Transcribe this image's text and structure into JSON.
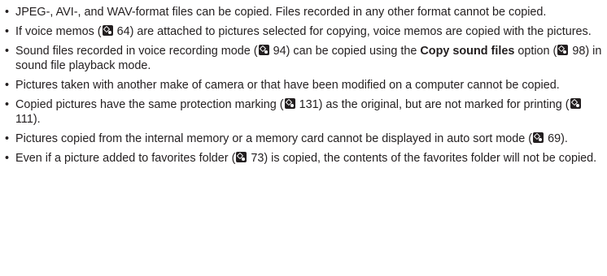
{
  "notes": {
    "i0": {
      "text": "JPEG-, AVI-, and WAV-format files can be copied. Files recorded in any other format cannot be copied."
    },
    "i1": {
      "pre": "If voice memos (",
      "p1": "64",
      "post": ") are attached to pictures selected for copying, voice memos are copied with the pictures."
    },
    "i2": {
      "pre": "Sound files recorded in voice recording mode (",
      "p1": "94",
      "mid": ") can be copied using the ",
      "bold": "Copy sound files",
      "mid2": " option (",
      "p2": "98",
      "post": ") in sound file playback mode."
    },
    "i3": {
      "text": "Pictures taken with another make of camera or that have been modified on a computer cannot be copied."
    },
    "i4": {
      "pre": "Copied pictures have the same protection marking (",
      "p1": "131",
      "mid": ") as the original, but are not marked for printing (",
      "p2": "111",
      "post": ")."
    },
    "i5": {
      "pre": "Pictures copied from the internal memory or a memory card cannot be displayed in auto sort mode (",
      "p1": "69",
      "post": ")."
    },
    "i6": {
      "pre": "Even if a picture added to favorites folder (",
      "p1": "73",
      "post": ") is copied, the contents of the favorites folder will not be copied."
    }
  },
  "bullet_glyph": "•",
  "reference_icon": "page-reference-icon"
}
